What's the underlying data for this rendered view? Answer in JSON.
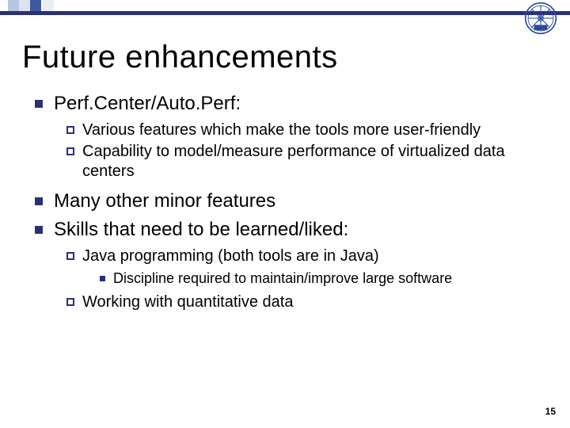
{
  "title": "Future enhancements",
  "bullets": {
    "b1": "Perf.Center/Auto.Perf:",
    "b1_1": "Various features which make the tools more user-friendly",
    "b1_2": "Capability to model/measure performance of virtualized data centers",
    "b2": "Many other minor features",
    "b3": "Skills that need to be learned/liked:",
    "b3_1": "Java programming (both tools are in Java)",
    "b3_1_1": "Discipline required to maintain/improve large software",
    "b3_2": "Working with quantitative data"
  },
  "page_number": "15"
}
